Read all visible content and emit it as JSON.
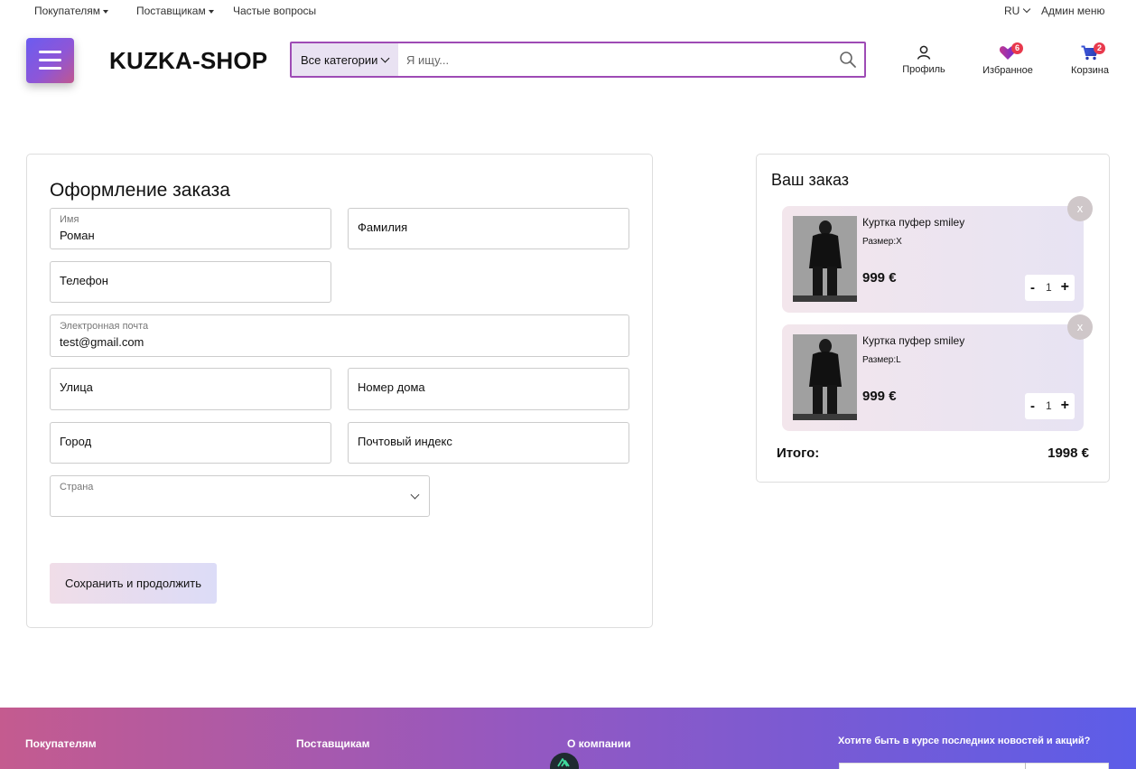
{
  "topbar": {
    "buyers": "Покупателям",
    "suppliers": "Поставщикам",
    "faq": "Частые вопросы",
    "lang": "RU",
    "admin": "Админ меню"
  },
  "header": {
    "logo": "KUZKA-SHOP",
    "category_button": "Все категории",
    "search_placeholder": "Я ищу...",
    "profile": "Профиль",
    "favorites": "Избранное",
    "favorites_count": "6",
    "cart": "Корзина",
    "cart_count": "2"
  },
  "form": {
    "title": "Оформление заказа",
    "first_name": {
      "label": "Имя",
      "value": "Роман"
    },
    "last_name": {
      "placeholder": "Фамилия"
    },
    "phone": {
      "placeholder": "Телефон"
    },
    "email": {
      "label": "Электронная почта",
      "value": "test@gmail.com"
    },
    "street": {
      "placeholder": "Улица"
    },
    "house": {
      "placeholder": "Номер дома"
    },
    "city": {
      "placeholder": "Город"
    },
    "postal": {
      "placeholder": "Почтовый индекс"
    },
    "country": {
      "label": "Страна",
      "value": ""
    },
    "save_button": "Сохранить и продолжить"
  },
  "order": {
    "title": "Ваш заказ",
    "items": [
      {
        "name": "Куртка пуфер smiley",
        "size": "Размер:X",
        "price": "999 €",
        "qty": "1",
        "remove": "x"
      },
      {
        "name": "Куртка пуфер smiley",
        "size": "Размер:L",
        "price": "999 €",
        "qty": "1",
        "remove": "x"
      }
    ],
    "minus": "-",
    "plus": "+",
    "total_label": "Итого:",
    "total_value": "1998 €"
  },
  "footer": {
    "buyers": "Покупателям",
    "suppliers": "Поставщикам",
    "about": "О компании",
    "newsletter": "Хотите быть в курсе последних новостей и акций?"
  },
  "colors": {
    "accent_purple": "#9e4bb5",
    "badge_red": "#e8394d",
    "footer_gradient_start": "#c45b8f",
    "footer_gradient_end": "#5c5de8"
  }
}
